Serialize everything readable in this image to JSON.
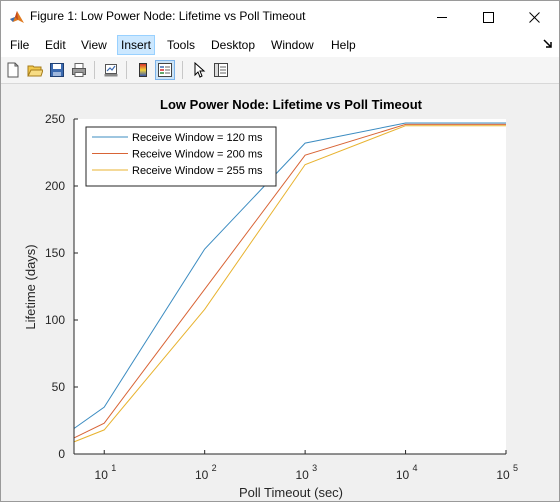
{
  "window": {
    "title": "Figure 1: Low Power Node: Lifetime vs Poll Timeout"
  },
  "menu": {
    "items": [
      "File",
      "Edit",
      "View",
      "Insert",
      "Tools",
      "Desktop",
      "Window",
      "Help"
    ],
    "active": "Insert"
  },
  "toolbar": {
    "buttons": [
      "new-figure-icon",
      "open-file-icon",
      "save-icon",
      "print-icon",
      "link-plot-icon",
      "insert-colorbar-icon",
      "insert-legend-icon",
      "pointer-icon",
      "property-editor-icon"
    ],
    "pressed": "insert-legend-icon"
  },
  "chart_data": {
    "type": "line",
    "title": "Low Power Node: Lifetime vs Poll Timeout",
    "xlabel": "Poll Timeout (sec)",
    "ylabel": "Lifetime (days)",
    "xscale": "log",
    "xlim": [
      5,
      100000
    ],
    "ylim": [
      0,
      250
    ],
    "x_ticks": [
      10,
      100,
      1000,
      10000,
      100000
    ],
    "x_tick_labels": [
      [
        "10",
        "1"
      ],
      [
        "10",
        "2"
      ],
      [
        "10",
        "3"
      ],
      [
        "10",
        "4"
      ],
      [
        "10",
        "5"
      ]
    ],
    "y_ticks": [
      0,
      50,
      100,
      150,
      200,
      250
    ],
    "y_tick_labels": [
      "0",
      "50",
      "100",
      "150",
      "200",
      "250"
    ],
    "grid": false,
    "legend": "top-left",
    "x": [
      5,
      10,
      100,
      1000,
      10000,
      100000
    ],
    "series": [
      {
        "name": "Receive Window = 120 ms",
        "color": "#3c8cc1",
        "values": [
          19,
          35,
          153,
          232,
          247,
          247
        ]
      },
      {
        "name": "Receive Window = 200 ms",
        "color": "#d86436",
        "values": [
          12,
          23,
          123,
          223,
          246,
          246
        ]
      },
      {
        "name": "Receive Window = 255 ms",
        "color": "#e8b330",
        "values": [
          9,
          18,
          108,
          216,
          245,
          245
        ]
      }
    ]
  }
}
